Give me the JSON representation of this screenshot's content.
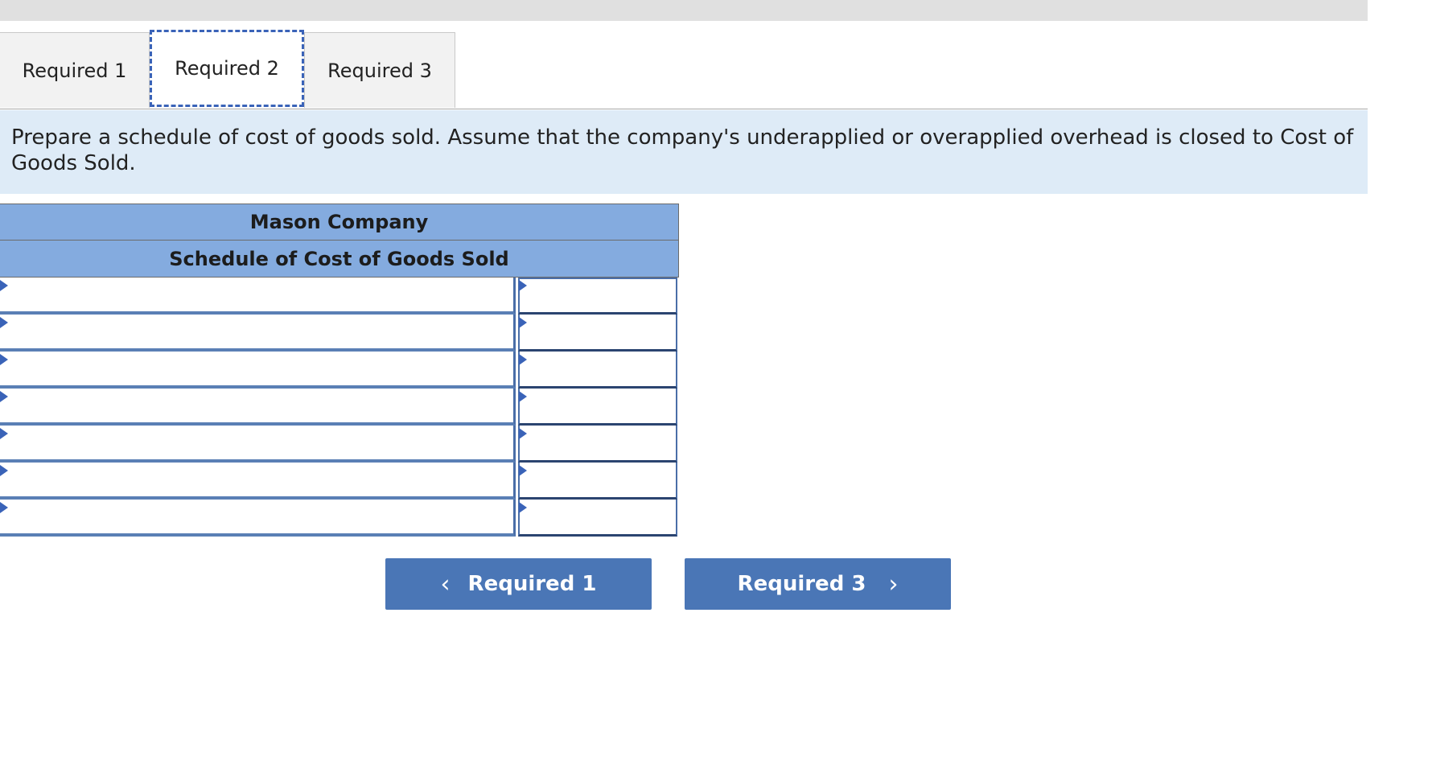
{
  "tabs": [
    {
      "label": "Required 1"
    },
    {
      "label": "Required 2"
    },
    {
      "label": "Required 3"
    }
  ],
  "instructions": "Prepare a schedule of cost of goods sold. Assume that the company's underapplied or overapplied overhead is closed to Cost of Goods Sold.",
  "schedule": {
    "company": "Mason Company",
    "title": "Schedule of Cost of Goods Sold",
    "rows": [
      {
        "label": "",
        "value": ""
      },
      {
        "label": "",
        "value": ""
      },
      {
        "label": "",
        "value": ""
      },
      {
        "label": "",
        "value": ""
      },
      {
        "label": "",
        "value": ""
      },
      {
        "label": "",
        "value": ""
      },
      {
        "label": "",
        "value": ""
      }
    ]
  },
  "nav": {
    "prev_label": "Required 1",
    "next_label": "Required 3",
    "prev_icon": "chevron-left-icon",
    "next_icon": "chevron-right-icon"
  },
  "colors": {
    "header_blue": "#84abdf",
    "instruction_bg": "#deebf7",
    "button_blue": "#4a76b6",
    "focus_outline": "#3a63b8"
  }
}
